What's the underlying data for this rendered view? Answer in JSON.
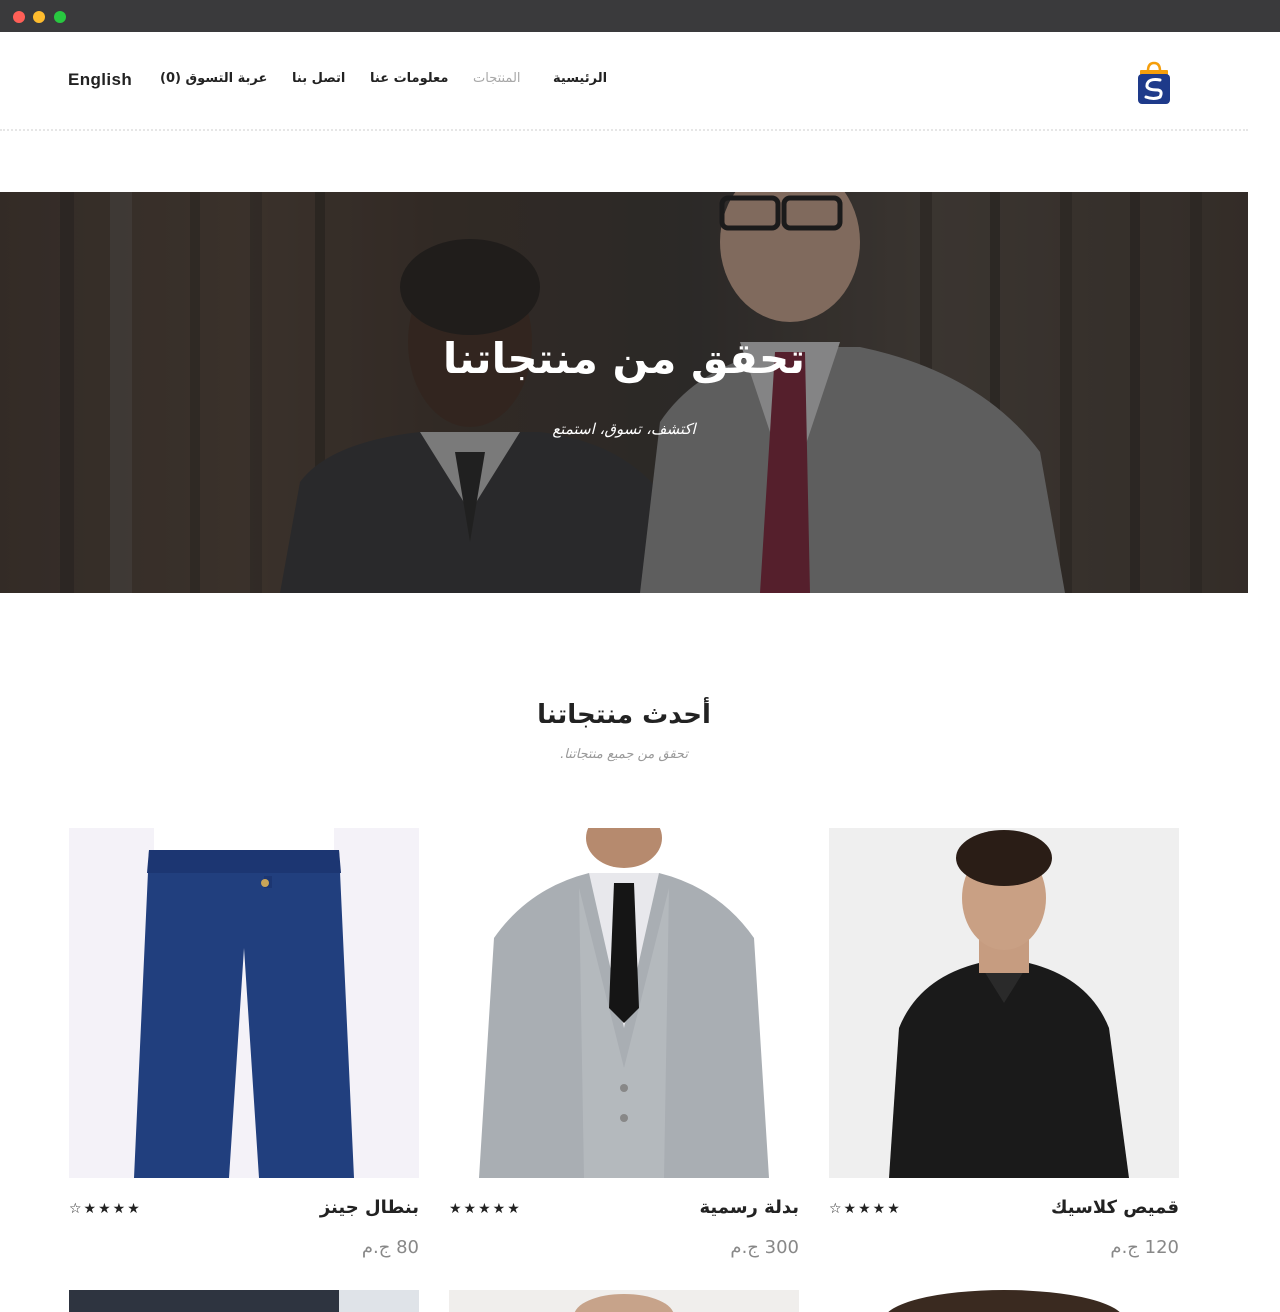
{
  "window": {
    "controls": [
      "close",
      "minimize",
      "maximize"
    ]
  },
  "header": {
    "logo_icon": "shopping-bag-logo-icon",
    "nav": {
      "home": "الرئيسية",
      "products": "المنتجات",
      "about": "معلومات عنا",
      "contact": "اتصل بنا",
      "cart": "عربة التسوق (0)"
    },
    "language": "English"
  },
  "hero": {
    "title": "تحقق من منتجاتنا",
    "subtitle": "اكتشف، تسوق، استمتع"
  },
  "latest": {
    "title": "أحدث منتجاتنا",
    "subtitle": "تحقق من جميع منتجاتنا."
  },
  "products": [
    {
      "name": "قميص كلاسيك",
      "rating": 4,
      "stars": "☆★★★★",
      "price": "120 ج.م"
    },
    {
      "name": "بدلة رسمية",
      "rating": 5,
      "stars": "★★★★★",
      "price": "300 ج.م"
    },
    {
      "name": "بنطال جينز",
      "rating": 4,
      "stars": "☆★★★★",
      "price": "80 ج.م"
    }
  ],
  "colors": {
    "titlebar": "#3a3a3c",
    "logo_blue": "#1e3a8a",
    "logo_orange": "#f59e0b",
    "text": "#222222",
    "muted": "#999999"
  }
}
